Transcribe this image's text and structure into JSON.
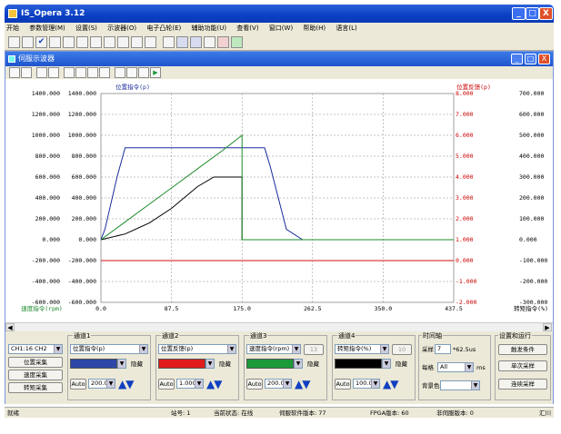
{
  "app": {
    "title": "IS_Opera 3.12",
    "window_buttons": [
      "_",
      "□",
      "X"
    ]
  },
  "menu": [
    "开始",
    "参数管理(M)",
    "设置(S)",
    "示波器(O)",
    "电子凸轮(E)",
    "辅助功能(U)",
    "查看(V)",
    "窗口(W)",
    "帮助(H)",
    "语言(L)"
  ],
  "scope": {
    "title": "伺服示波器",
    "chart_data": {
      "type": "line",
      "x_ticks": [
        "0.0",
        "87.5",
        "175.0",
        "262.5",
        "350.0",
        "437.5"
      ],
      "xlim": [
        0,
        437.5
      ],
      "title_left": "位置指令(p)",
      "title_right": "位置反馈(p)",
      "bottom_left_label": "速度指令(rpm)",
      "bottom_right_label": "转矩指令(%)",
      "axis1_ticks": [
        "1400.000",
        "1200.000",
        "1000.000",
        "800.000",
        "600.000",
        "400.000",
        "200.000",
        "0.000",
        "-200.000",
        "-400.000",
        "-600.000"
      ],
      "axis2_ticks": [
        "1400.000",
        "1200.000",
        "1000.000",
        "800.000",
        "600.000",
        "400.000",
        "200.000",
        "0.000",
        "-200.000",
        "-400.000",
        "-600.000"
      ],
      "axis3_ticks": [
        "8.000",
        "7.000",
        "6.000",
        "5.000",
        "4.000",
        "3.000",
        "2.000",
        "1.000",
        "0.000",
        "-1.000",
        "-2.000"
      ],
      "axis4_ticks": [
        "700.000",
        "600.000",
        "500.000",
        "400.000",
        "300.000",
        "200.000",
        "100.000",
        "0.000",
        "-100.000",
        "-200.000",
        "-300.000"
      ],
      "ylim": [
        -600,
        1400
      ],
      "colors": {
        "ch1": "#1a2a9c",
        "ch2": "#000000",
        "ch3": "#1d8c2a",
        "ch4": "#cc1111"
      },
      "series": [
        {
          "color": "ch1",
          "x": [
            0,
            5,
            20,
            30,
            50,
            80,
            110,
            140,
            170,
            197,
            203,
            210,
            220,
            230,
            250,
            400,
            437.5
          ],
          "y": [
            0,
            100,
            600,
            880,
            880,
            880,
            880,
            880,
            880,
            880,
            880,
            700,
            400,
            100,
            0,
            0,
            0
          ]
        },
        {
          "color": "ch2",
          "x": [
            0,
            30,
            60,
            87.5,
            120,
            140,
            160,
            175,
            175,
            250,
            437.5
          ],
          "y": [
            0,
            55,
            160,
            300,
            510,
            600,
            600,
            600,
            0,
            0,
            0
          ]
        },
        {
          "color": "ch3",
          "x": [
            0,
            30,
            60,
            90,
            120,
            150,
            175,
            175,
            250,
            437.5
          ],
          "y": [
            0,
            170,
            340,
            510,
            680,
            850,
            1000,
            0,
            0,
            0
          ]
        },
        {
          "color": "ch4",
          "x": [
            0,
            437.5
          ],
          "y": [
            -200,
            -200
          ]
        }
      ]
    }
  },
  "ctrl": {
    "ch_select": "CH1:16 CH2",
    "btn_pos": "位置采集",
    "btn_speed": "速度采集",
    "btn_torque": "转矩采集",
    "channels": [
      {
        "label": "通道1",
        "signal": "位置指令(p)",
        "hide": "隐藏",
        "auto": "Auto",
        "scale": "200.00",
        "color": "#2d47a8"
      },
      {
        "label": "通道2",
        "signal": "位置反馈(p)",
        "hide": "隐藏",
        "auto": "Auto",
        "scale": "1.000",
        "color": "#e01b1b"
      },
      {
        "label": "通道3",
        "signal": "速度指令(rpm)",
        "hide": "隐藏",
        "auto": "Auto",
        "scale": "200.00",
        "color": "#1c9a3a",
        "extra": "13"
      },
      {
        "label": "通道4",
        "signal": "转矩指令(%)",
        "hide": "隐藏",
        "auto": "Auto",
        "scale": "100.00",
        "color": "#000000",
        "extra": "10"
      }
    ],
    "time": {
      "label": "时间轴",
      "sample": "采样",
      "sample_val": "7",
      "unit": "*62.5us",
      "per": "每格",
      "per_val": "All",
      "per_unit": "ms",
      "bg": "背景色"
    },
    "run": {
      "label": "设置和运行",
      "trigger": "触发条件",
      "single": "单次采样",
      "continuous": "连续采样"
    }
  },
  "status": {
    "ready": "就绪",
    "station": "站号: 1",
    "state": "当前状态: 在线",
    "servo_ver": "伺服软件版本: 77",
    "fpga_ver": "FPGA版本: 60",
    "panel_ver": "非伺服版本: 0",
    "right": "汇川"
  }
}
